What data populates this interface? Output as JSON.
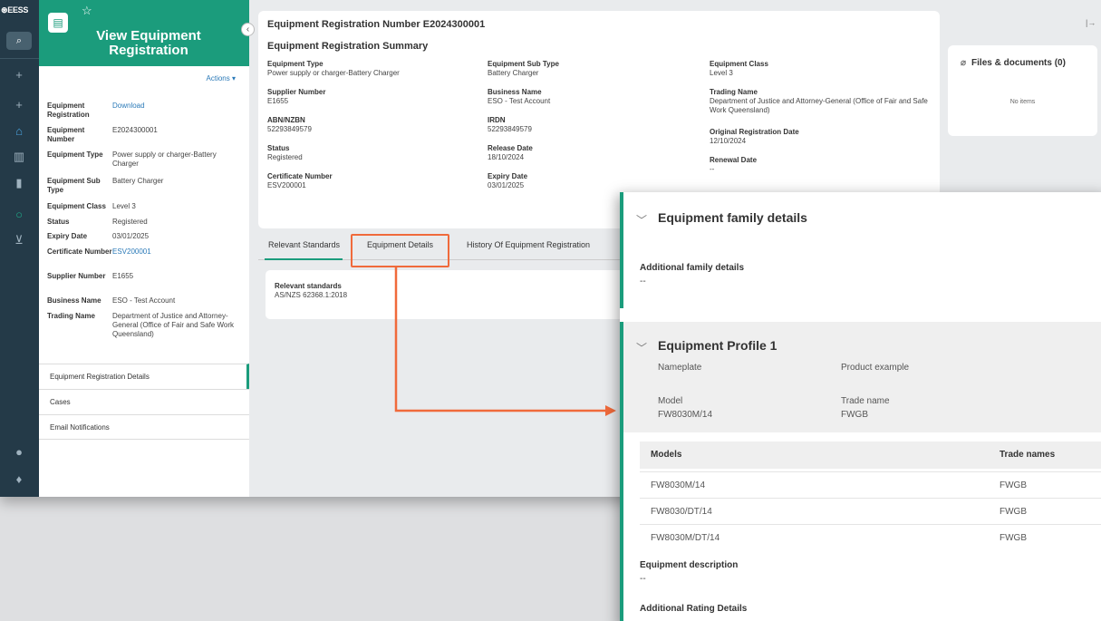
{
  "nav": {
    "logo": "⊛EESS"
  },
  "sidebar": {
    "title": "View Equipment Registration",
    "actions_label": "Actions ▾",
    "fields": [
      {
        "key": "Equipment Registration",
        "value": "Download",
        "link": true
      },
      {
        "key": "Equipment Number",
        "value": "E2024300001",
        "link": false
      },
      {
        "key": "Equipment Type",
        "value": "Power supply or charger-Battery Charger",
        "link": false
      },
      {
        "key": "Equipment Sub Type",
        "value": "Battery Charger",
        "link": false
      },
      {
        "key": "Equipment Class",
        "value": "Level 3",
        "link": false
      },
      {
        "key": "Status",
        "value": "Registered",
        "link": false
      },
      {
        "key": "Expiry Date",
        "value": "03/01/2025",
        "link": false
      },
      {
        "key": "Certificate Number",
        "value": "ESV200001",
        "link": true
      },
      {
        "key": "Supplier Number",
        "value": "E1655",
        "link": false
      },
      {
        "key": "Business Name",
        "value": "ESO - Test Account",
        "link": false
      },
      {
        "key": "Trading Name",
        "value": "Department of Justice and Attorney-General (Office of Fair and Safe Work Queensland)",
        "link": false
      }
    ],
    "tabs": [
      "Equipment Registration Details",
      "Cases",
      "Email Notifications"
    ]
  },
  "summary": {
    "heading": "Equipment Registration Number E2024300001",
    "subheading": "Equipment Registration Summary",
    "col1": [
      {
        "key": "Equipment Type",
        "value": "Power supply or charger-Battery Charger"
      },
      {
        "key": "Supplier Number",
        "value": "E1655"
      },
      {
        "key": "ABN/NZBN",
        "value": "52293849579"
      },
      {
        "key": "Status",
        "value": "Registered"
      },
      {
        "key": "Certificate Number",
        "value": "ESV200001"
      }
    ],
    "col2": [
      {
        "key": "Equipment Sub Type",
        "value": "Battery Charger"
      },
      {
        "key": "Business Name",
        "value": "ESO - Test Account"
      },
      {
        "key": "IRDN",
        "value": "52293849579"
      },
      {
        "key": "Release Date",
        "value": "18/10/2024"
      },
      {
        "key": "Expiry Date",
        "value": "03/01/2025"
      }
    ],
    "col3": [
      {
        "key": "Equipment Class",
        "value": "Level 3"
      },
      {
        "key": "Trading Name",
        "value": "Department of Justice and Attorney-General (Office of Fair and Safe Work Queensland)"
      },
      {
        "key": "Original Registration Date",
        "value": "12/10/2024"
      },
      {
        "key": "Renewal Date",
        "value": "--"
      }
    ]
  },
  "files": {
    "title": "Files & documents (0)",
    "empty": "No items"
  },
  "tabs": [
    "Relevant Standards",
    "Equipment Details",
    "History Of Equipment Registration"
  ],
  "standards": {
    "label": "Relevant standards",
    "value": "AS/NZS 62368.1:2018"
  },
  "zoom": {
    "family_title": "Equipment family details",
    "additional_family_label": "Additional family details",
    "additional_family_value": "--",
    "profile_title": "Equipment Profile 1",
    "nameplate_label": "Nameplate",
    "product_example_label": "Product example",
    "model_label": "Model",
    "model_value": "FW8030M/14",
    "trade_name_label": "Trade name",
    "trade_name_value": "FWGB",
    "table_headers": [
      "Models",
      "Trade names"
    ],
    "table_rows": [
      [
        "FW8030M/14",
        "FWGB"
      ],
      [
        "FW8030/DT/14",
        "FWGB"
      ],
      [
        "FW8030M/DT/14",
        "FWGB"
      ]
    ],
    "equipment_description_label": "Equipment description",
    "equipment_description_value": "--",
    "additional_rating_label": "Additional Rating Details"
  },
  "colors": {
    "brand": "#1b9c7c",
    "highlight": "#f06a3b",
    "nav": "#243a48",
    "link": "#2b7ab8"
  }
}
